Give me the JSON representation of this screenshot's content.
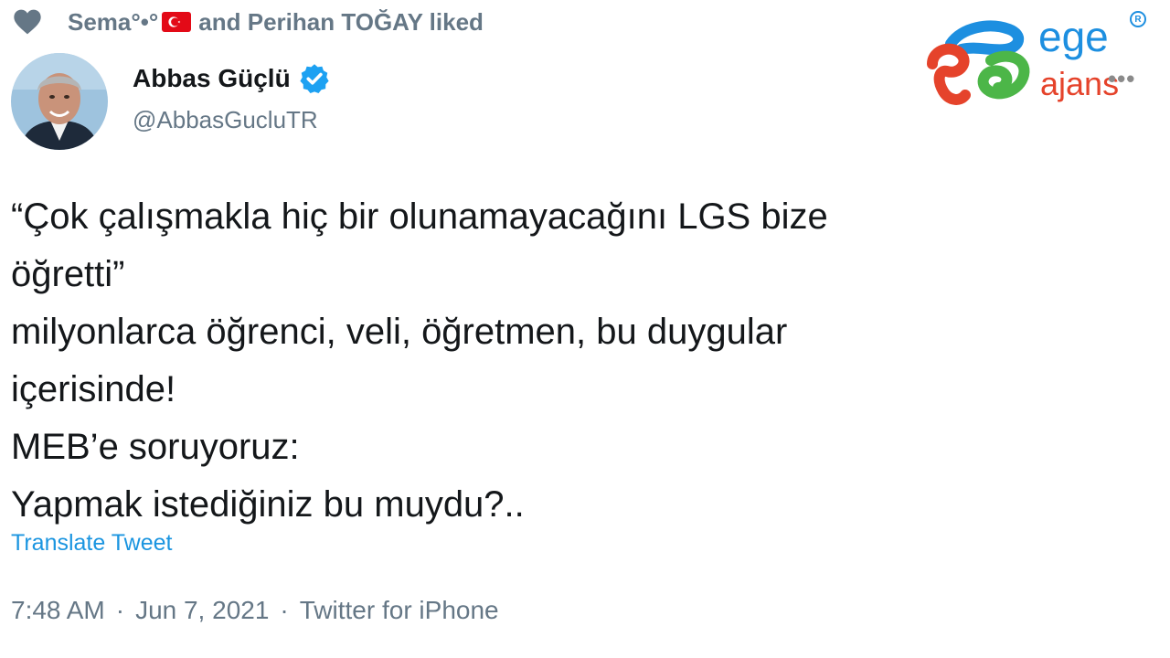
{
  "liked": {
    "user1": "Sema°•°",
    "text": "and Perihan TOĞAY liked"
  },
  "author": {
    "name": "Abbas Güçlü",
    "handle": "@AbbasGucluTR",
    "verified": true
  },
  "tweet": {
    "lines": [
      "“Çok çalışmakla hiç bir olunamayacağını LGS bize",
      "öğretti”",
      "milyonlarca öğrenci, veli, öğretmen, bu duygular",
      "içerisinde!",
      "MEB’e soruyoruz:",
      "Yapmak istediğiniz bu muydu?.."
    ],
    "translate_label": "Translate Tweet"
  },
  "meta": {
    "time": "7:48 AM",
    "date": "Jun 7, 2021",
    "source": "Twitter for iPhone",
    "separator": "·"
  },
  "watermark": {
    "line1": "ege",
    "line2": "ajans",
    "registered": "R"
  },
  "colors": {
    "link": "#1b95e0",
    "secondary": "#657786",
    "text": "#14171a",
    "verified": "#1da1f2",
    "logo_blue": "#1d8fe0",
    "logo_red": "#e5432b",
    "logo_green": "#4cb648"
  }
}
